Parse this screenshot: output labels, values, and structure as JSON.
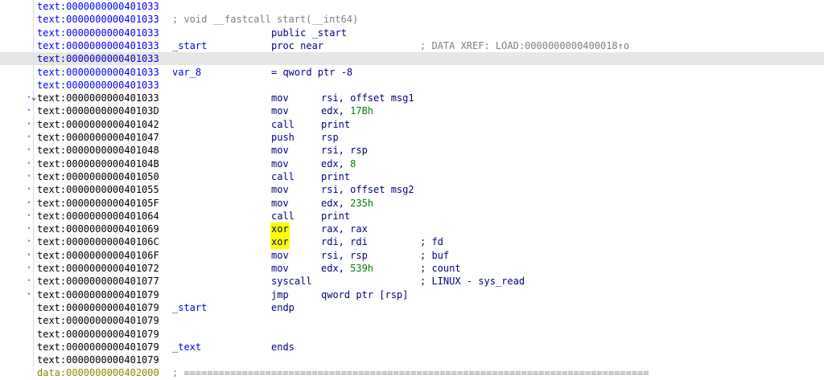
{
  "listing": {
    "rows": [
      {
        "addr": "text:0000000000401033"
      },
      {
        "addr": "text:0000000000401033",
        "comment": "; void __fastcall start(__int64)"
      },
      {
        "addr": "text:0000000000401033",
        "mnem": "public _start"
      },
      {
        "addr": "text:0000000000401033",
        "label": "_start",
        "mnem": "proc near",
        "cmt": "; DATA XREF: LOAD:0000000000400018↑o"
      },
      {
        "addr": "text:0000000000401033",
        "highlight": true
      },
      {
        "addr": "text:0000000000401033",
        "label": "var_8",
        "mnem": "= qword ptr -8"
      },
      {
        "addr": "text:0000000000401033"
      },
      {
        "addr": "text:0000000000401033",
        "code": true,
        "marker": true,
        "chevron": true,
        "mnem": "mov",
        "ops": "rsi, offset msg1"
      },
      {
        "addr": "text:000000000040103D",
        "code": true,
        "marker": true,
        "mnem": "mov",
        "ops": "edx, ",
        "num": "17Bh"
      },
      {
        "addr": "text:0000000000401042",
        "code": true,
        "marker": true,
        "mnem": "call",
        "ops": "print"
      },
      {
        "addr": "text:0000000000401047",
        "code": true,
        "marker": true,
        "mnem": "push",
        "ops": "rsp"
      },
      {
        "addr": "text:0000000000401048",
        "code": true,
        "marker": true,
        "mnem": "mov",
        "ops": "rsi, rsp"
      },
      {
        "addr": "text:000000000040104B",
        "code": true,
        "marker": true,
        "mnem": "mov",
        "ops": "edx, ",
        "num": "8"
      },
      {
        "addr": "text:0000000000401050",
        "code": true,
        "marker": true,
        "mnem": "call",
        "ops": "print"
      },
      {
        "addr": "text:0000000000401055",
        "code": true,
        "marker": true,
        "mnem": "mov",
        "ops": "rsi, offset msg2"
      },
      {
        "addr": "text:000000000040105F",
        "code": true,
        "marker": true,
        "mnem": "mov",
        "ops": "edx, ",
        "num": "235h"
      },
      {
        "addr": "text:0000000000401064",
        "code": true,
        "marker": true,
        "mnem": "call",
        "ops": "print"
      },
      {
        "addr": "text:0000000000401069",
        "code": true,
        "marker": true,
        "mnem": "xor",
        "mnem_hl": true,
        "ops": "rax, rax"
      },
      {
        "addr": "text:000000000040106C",
        "code": true,
        "marker": true,
        "mnem": "xor",
        "mnem_hl": true,
        "ops": "rdi, rdi",
        "cmt": "; fd"
      },
      {
        "addr": "text:000000000040106F",
        "code": true,
        "marker": true,
        "mnem": "mov",
        "ops": "rsi, rsp",
        "cmt": "; buf"
      },
      {
        "addr": "text:0000000000401072",
        "code": true,
        "marker": true,
        "mnem": "mov",
        "ops": "edx, ",
        "num": "539h",
        "cmt": "; count"
      },
      {
        "addr": "text:0000000000401077",
        "code": true,
        "marker": true,
        "mnem": "syscall",
        "cmt": "; LINUX - sys_read"
      },
      {
        "addr": "text:0000000000401079",
        "code": true,
        "marker": true,
        "mnem": "jmp",
        "ops": "qword ptr [rsp]"
      },
      {
        "addr": "text:0000000000401079",
        "code": true,
        "label": "_start",
        "mnem": "endp"
      },
      {
        "addr": "text:0000000000401079",
        "code": true
      },
      {
        "addr": "text:0000000000401079",
        "code": true
      },
      {
        "addr": "text:0000000000401079",
        "code": true,
        "label": "_text",
        "mnem": "ends"
      },
      {
        "addr": "text:0000000000401079",
        "code": true
      },
      {
        "addr": "data:0000000000402000",
        "data": true,
        "sep": "; ================================================================================"
      }
    ]
  },
  "colors": {
    "address": "#0000ff",
    "code_address": "#000000",
    "data_address": "#8a8a00",
    "number": "#008000",
    "highlight_bg": "#e6e6e6",
    "mnemonic_highlight": "#ffff00"
  }
}
